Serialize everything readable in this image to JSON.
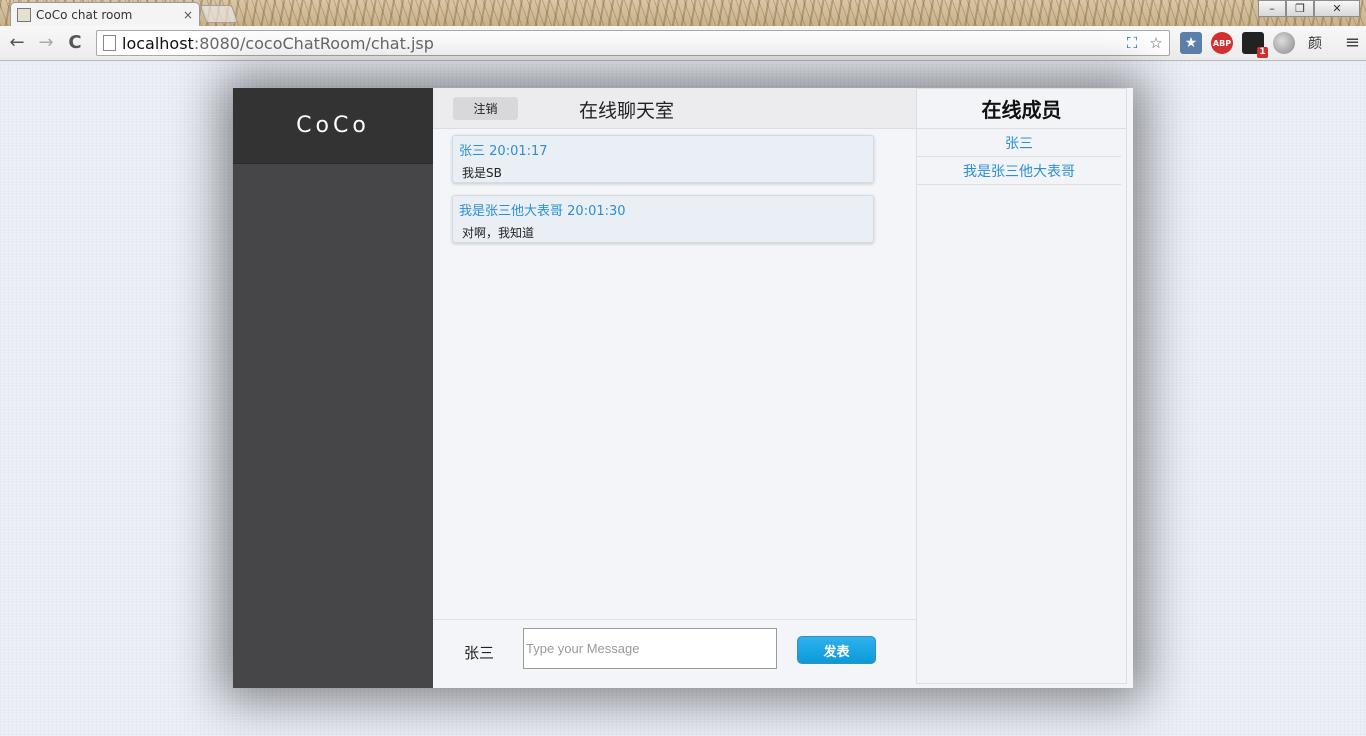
{
  "browser": {
    "tab_title": "CoCo chat room",
    "tab_close": "×",
    "url_host": "localhost",
    "url_path": ":8080/cocoChatRoom/chat.jsp",
    "back_glyph": "←",
    "forward_glyph": "→",
    "reload_glyph": "C",
    "menu_glyph": "≡",
    "minimize_glyph": "–",
    "restore_glyph": "❐",
    "close_glyph": "✕",
    "star_glyph": "☆",
    "bookmark_ext_glyph": "★",
    "abp_label": "ABP",
    "mail_badge": "1",
    "yan_label": "颜"
  },
  "app": {
    "brand": "CoCo",
    "logout_label": "注销",
    "chat_title": "在线聊天室",
    "messages": [
      {
        "sender": "张三",
        "time": "20:01:17",
        "text": "我是SB"
      },
      {
        "sender": "我是张三他大表哥",
        "time": "20:01:30",
        "text": "对啊，我知道"
      }
    ],
    "composer": {
      "current_user": "张三",
      "input_placeholder": "Type your Message",
      "input_value": "",
      "send_label": "发表"
    },
    "members": {
      "title": "在线成员",
      "list": [
        "张三",
        "我是张三他大表哥"
      ]
    }
  },
  "colors": {
    "accent": "#2c8fd6",
    "send_button": "#1aa6e6",
    "sidebar": "#464649"
  }
}
